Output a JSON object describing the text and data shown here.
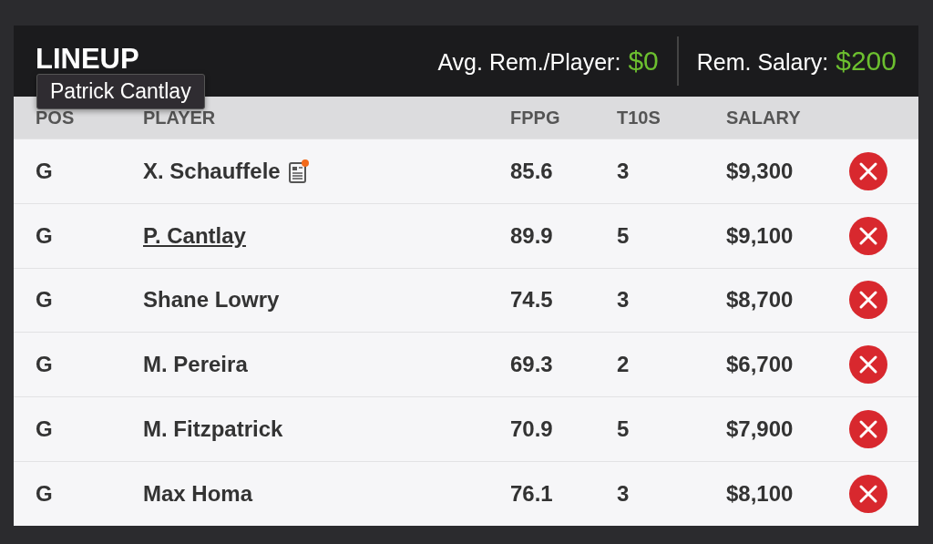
{
  "header": {
    "title": "LINEUP",
    "avg_label": "Avg. Rem./Player:",
    "avg_value": "$0",
    "rem_label": "Rem. Salary:",
    "rem_value": "$200"
  },
  "tooltip": "Patrick Cantlay",
  "columns": [
    "POS",
    "PLAYER",
    "FPPG",
    "T10S",
    "SALARY"
  ],
  "rows": [
    {
      "pos": "G",
      "player": "X. Schauffele",
      "news": true,
      "hovered": false,
      "fppg": "85.6",
      "t10s": "3",
      "salary": "$9,300"
    },
    {
      "pos": "G",
      "player": "P. Cantlay",
      "news": false,
      "hovered": true,
      "fppg": "89.9",
      "t10s": "5",
      "salary": "$9,100"
    },
    {
      "pos": "G",
      "player": "Shane Lowry",
      "news": false,
      "hovered": false,
      "fppg": "74.5",
      "t10s": "3",
      "salary": "$8,700"
    },
    {
      "pos": "G",
      "player": "M. Pereira",
      "news": false,
      "hovered": false,
      "fppg": "69.3",
      "t10s": "2",
      "salary": "$6,700"
    },
    {
      "pos": "G",
      "player": "M. Fitzpatrick",
      "news": false,
      "hovered": false,
      "fppg": "70.9",
      "t10s": "5",
      "salary": "$7,900"
    },
    {
      "pos": "G",
      "player": "Max Homa",
      "news": false,
      "hovered": false,
      "fppg": "76.1",
      "t10s": "3",
      "salary": "$8,100"
    }
  ]
}
